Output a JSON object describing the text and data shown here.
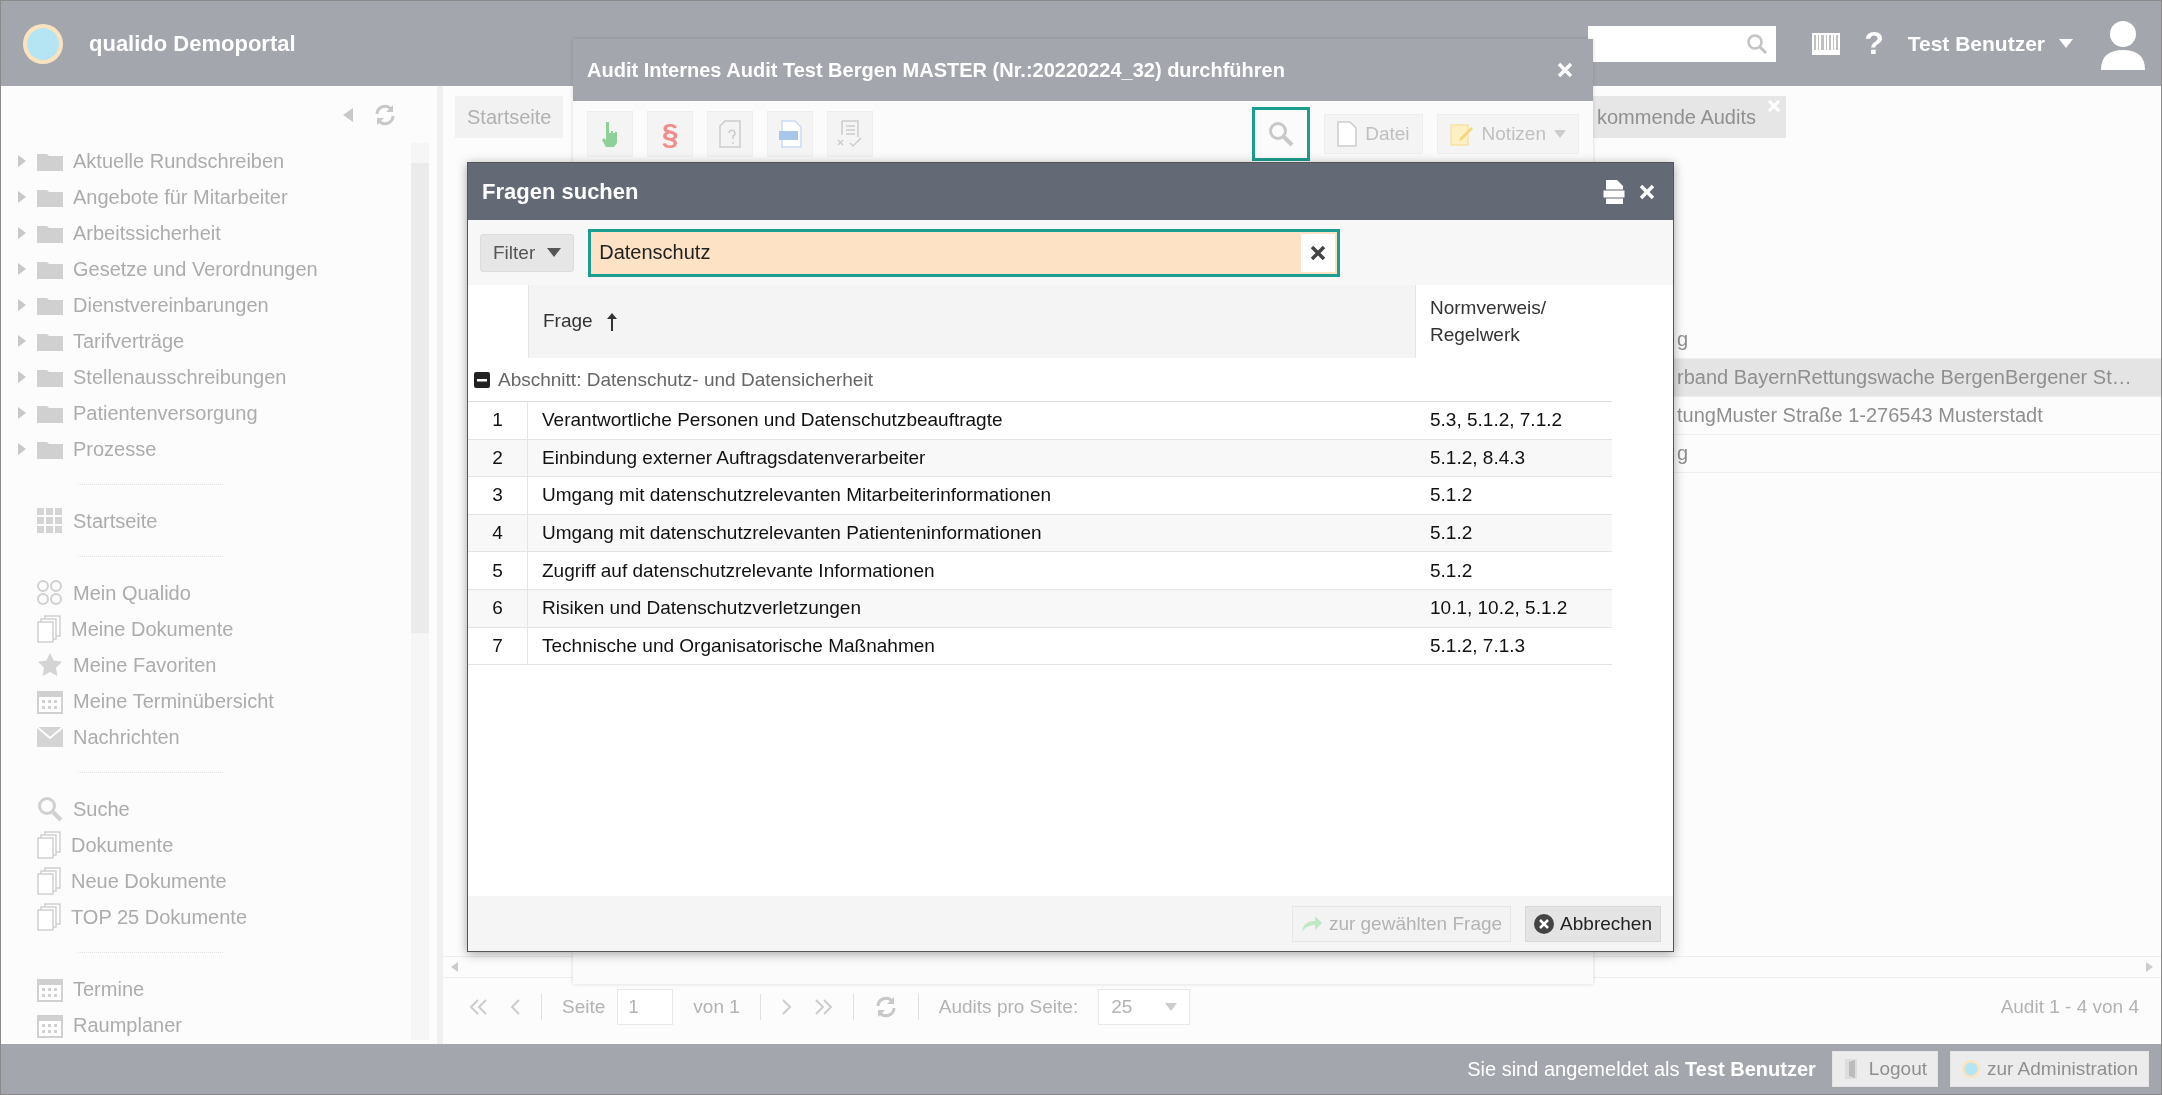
{
  "header": {
    "brand": "qualido Demoportal",
    "help": "?",
    "user": "Test Benutzer"
  },
  "sidebar": {
    "folders": [
      {
        "label": "Aktuelle Rundschreiben",
        "expanded": false
      },
      {
        "label": "Angebote für Mitarbeiter",
        "expanded": false
      },
      {
        "label": "Arbeitssicherheit",
        "expanded": false
      },
      {
        "label": "Gesetze und Verordnungen",
        "expanded": false
      },
      {
        "label": "Dienstvereinbarungen",
        "expanded": false
      },
      {
        "label": "Tarifverträge",
        "expanded": false
      },
      {
        "label": "Stellenausschreibungen",
        "expanded": false
      },
      {
        "label": "Patientenversorgung",
        "expanded": false
      },
      {
        "label": "Prozesse",
        "expanded": false
      }
    ],
    "sections": [
      [
        {
          "label": "Startseite",
          "kind": "grid"
        }
      ],
      [
        {
          "label": "Mein Qualido",
          "kind": "qualido"
        },
        {
          "label": "Meine Dokumente",
          "kind": "docs"
        },
        {
          "label": "Meine Favoriten",
          "kind": "star"
        },
        {
          "label": "Meine Terminübersicht",
          "kind": "calendar"
        },
        {
          "label": "Nachrichten",
          "kind": "mail"
        }
      ],
      [
        {
          "label": "Suche",
          "kind": "search"
        },
        {
          "label": "Dokumente",
          "kind": "docs"
        },
        {
          "label": "Neue Dokumente",
          "kind": "docs"
        },
        {
          "label": "TOP 25 Dokumente",
          "kind": "docs"
        }
      ],
      [
        {
          "label": "Termine",
          "kind": "calendar"
        },
        {
          "label": "Raumplaner",
          "kind": "calendar"
        }
      ]
    ]
  },
  "main": {
    "tabs": [
      {
        "label": "Startseite",
        "selected": false,
        "closable": false
      },
      {
        "label": "kommende Audits",
        "selected": true,
        "closable": true
      }
    ],
    "rows": [
      {
        "text": "g",
        "highlighted": false
      },
      {
        "text": "rband BayernRettungswache BergenBergener St…",
        "highlighted": true
      },
      {
        "text": "tungMuster Straße 1-276543 Musterstadt",
        "highlighted": false
      },
      {
        "text": "g",
        "highlighted": false
      }
    ],
    "pager": {
      "page_label": "Seite",
      "page": "1",
      "of": "von 1",
      "per_page_label": "Audits pro Seite:",
      "per_page": "25",
      "summary": "Audit 1 - 4 von 4"
    }
  },
  "audit_dialog": {
    "title": "Audit Internes Audit Test Bergen MASTER (Nr.:20220224_32) durchführen",
    "toolbar": [
      {
        "kind": "hand"
      },
      {
        "kind": "paragraph",
        "label": "§"
      },
      {
        "kind": "question-doc"
      },
      {
        "kind": "iso"
      },
      {
        "kind": "checklist"
      }
    ],
    "search_active": true,
    "file_button": "Datei",
    "notes_button": "Notizen"
  },
  "search_dialog": {
    "title": "Fragen suchen",
    "filter_button": "Filter",
    "search": {
      "value": "Datenschutz"
    },
    "columns": [
      {
        "label": "Frage",
        "sorted": true
      },
      {
        "label": "Normverweis/ Regelwerk",
        "sorted": false
      }
    ],
    "groups": [
      {
        "label": "Abschnitt: Datenschutz- und Datensicherheit",
        "expanded": true,
        "rows": [
          {
            "number": "1",
            "question": "Verantwortliche Personen und Datenschutzbeauftragte",
            "norm": "5.3, 5.1.2, 7.1.2"
          },
          {
            "number": "2",
            "question": "Einbindung externer Auftragsdatenverarbeiter",
            "norm": "5.1.2, 8.4.3"
          },
          {
            "number": "3",
            "question": "Umgang mit datenschutzrelevanten Mitarbeiterinformationen",
            "norm": "5.1.2"
          },
          {
            "number": "4",
            "question": "Umgang mit datenschutzrelevanten Patienteninformationen",
            "norm": "5.1.2"
          },
          {
            "number": "5",
            "question": "Zugriff auf datenschutzrelevante Informationen",
            "norm": "5.1.2"
          },
          {
            "number": "6",
            "question": "Risiken und Datenschutzverletzungen",
            "norm": "10.1, 10.2, 5.1.2"
          },
          {
            "number": "7",
            "question": "Technische und Organisatorische Maßnahmen",
            "norm": "5.1.2, 7.1.3"
          }
        ]
      }
    ],
    "buttons": [
      {
        "label": "zur gewählten Frage",
        "kind": "goto",
        "disabled": true
      },
      {
        "label": "Abbrechen",
        "kind": "cancel",
        "disabled": false
      }
    ]
  },
  "footer": {
    "login_text": "Sie sind angemeldet als **Test Benutzer**",
    "logout": "Logout",
    "admin": "zur Administration"
  }
}
